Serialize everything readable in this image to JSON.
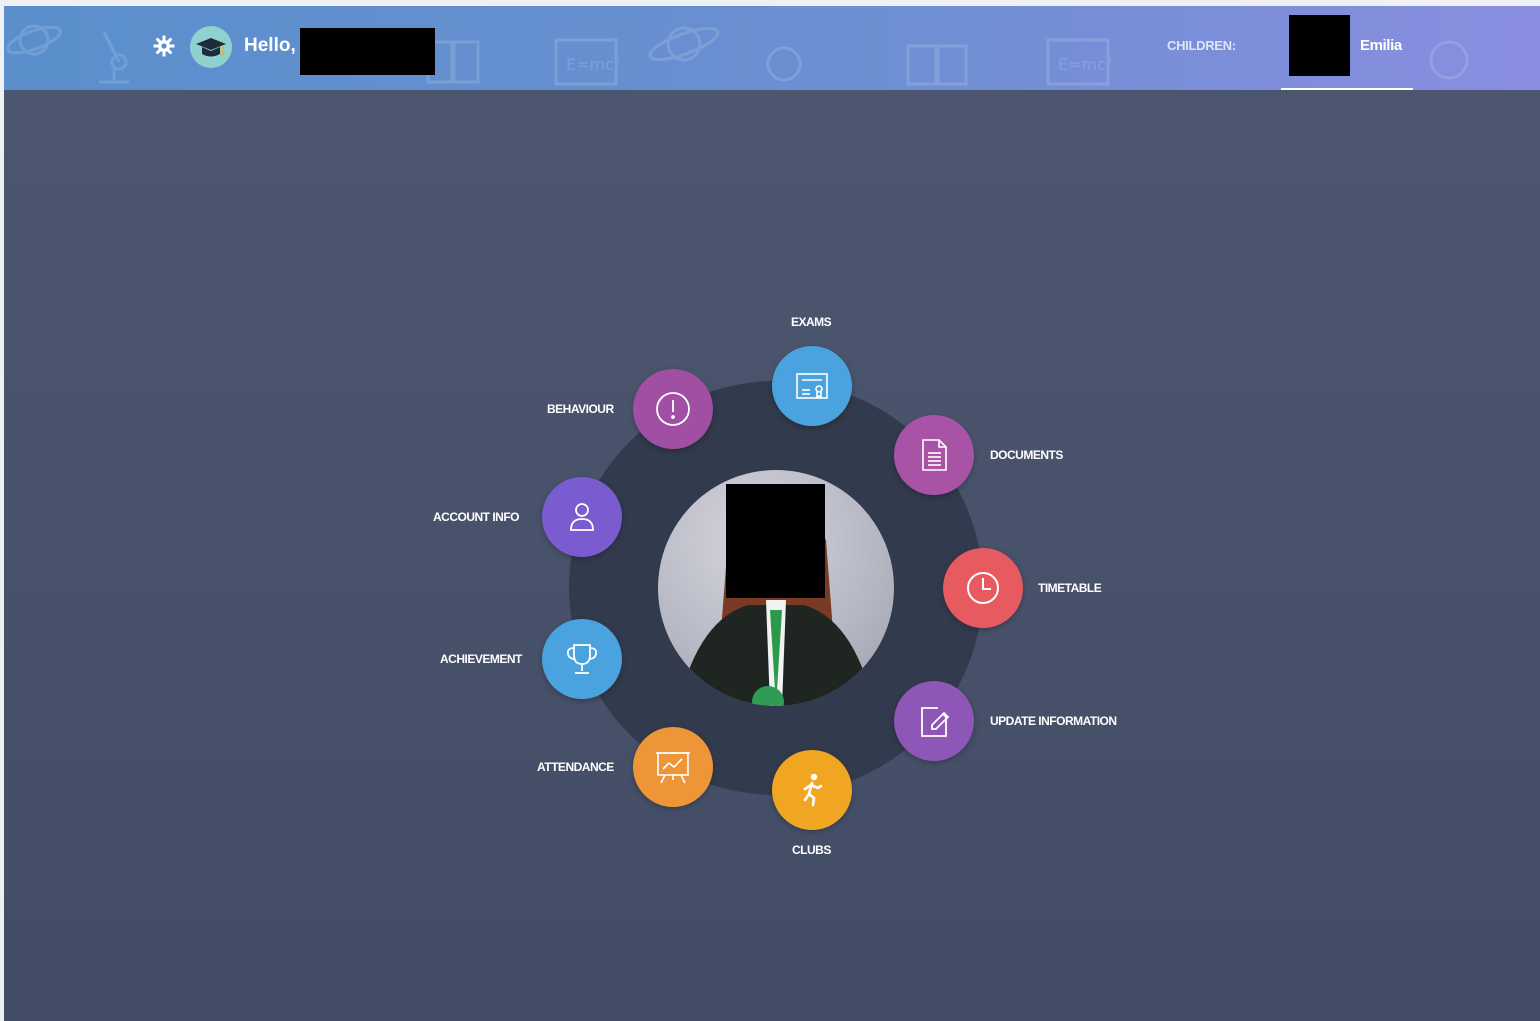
{
  "header": {
    "greeting": "Hello,",
    "children_label": "CHILDREN:",
    "child_name": "Emilia"
  },
  "menu": {
    "exams": "EXAMS",
    "documents": "DOCUMENTS",
    "timetable": "TIMETABLE",
    "update_information": "UPDATE INFORMATION",
    "clubs": "CLUBS",
    "attendance": "ATTENDANCE",
    "achievement": "ACHIEVEMENT",
    "account_info": "ACCOUNT INFO",
    "behaviour": "BEHAVIOUR"
  },
  "colors": {
    "exams": "#4aa3de",
    "documents": "#a953a6",
    "timetable": "#e75a5f",
    "update_information": "#8e56b6",
    "clubs": "#f0a623",
    "attendance": "#ee9637",
    "achievement": "#4aa3de",
    "account_info": "#7a5bd0",
    "behaviour": "#a04fa3"
  },
  "icons": {
    "exams": "certificate-icon",
    "documents": "document-icon",
    "timetable": "clock-icon",
    "update_information": "edit-icon",
    "clubs": "runner-icon",
    "attendance": "chart-board-icon",
    "achievement": "trophy-icon",
    "account_info": "user-icon",
    "behaviour": "exclamation-icon"
  }
}
